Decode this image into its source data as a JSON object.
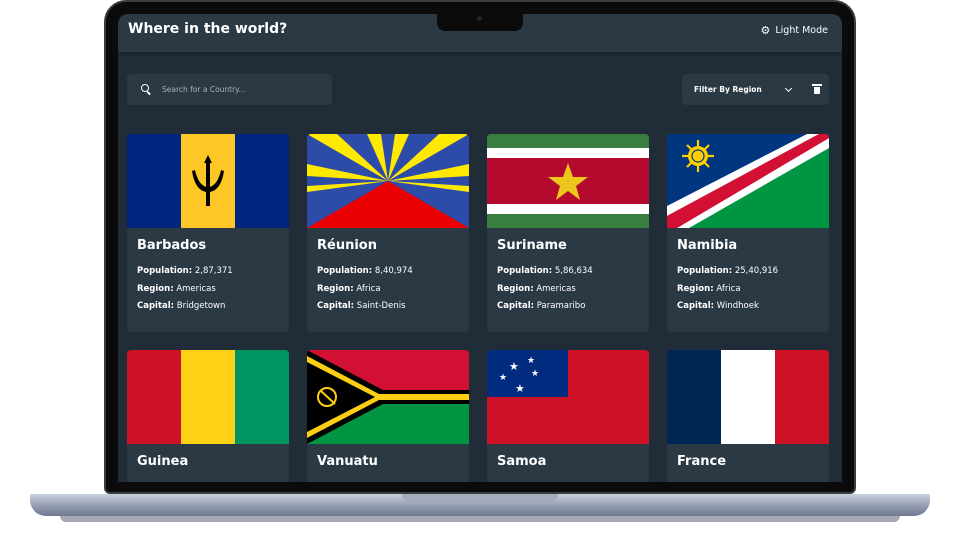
{
  "header": {
    "title": "Where in the world?",
    "mode_label": "Light Mode",
    "mode_icon": "gear-icon"
  },
  "search": {
    "placeholder": "Search for a Country...",
    "value": ""
  },
  "filter": {
    "label": "Filter By Region"
  },
  "labels": {
    "population": "Population:",
    "region": "Region:",
    "capital": "Capital:"
  },
  "countries": [
    {
      "name": "Barbados",
      "population": "2,87,371",
      "region": "Americas",
      "capital": "Bridgetown"
    },
    {
      "name": "Réunion",
      "population": "8,40,974",
      "region": "Africa",
      "capital": "Saint-Denis"
    },
    {
      "name": "Suriname",
      "population": "5,86,634",
      "region": "Americas",
      "capital": "Paramaribo"
    },
    {
      "name": "Namibia",
      "population": "25,40,916",
      "region": "Africa",
      "capital": "Windhoek"
    },
    {
      "name": "Guinea"
    },
    {
      "name": "Vanuatu"
    },
    {
      "name": "Samoa"
    },
    {
      "name": "France"
    }
  ],
  "colors": {
    "background": "#202c37",
    "elements": "#2b3945",
    "text": "#ffffff"
  }
}
